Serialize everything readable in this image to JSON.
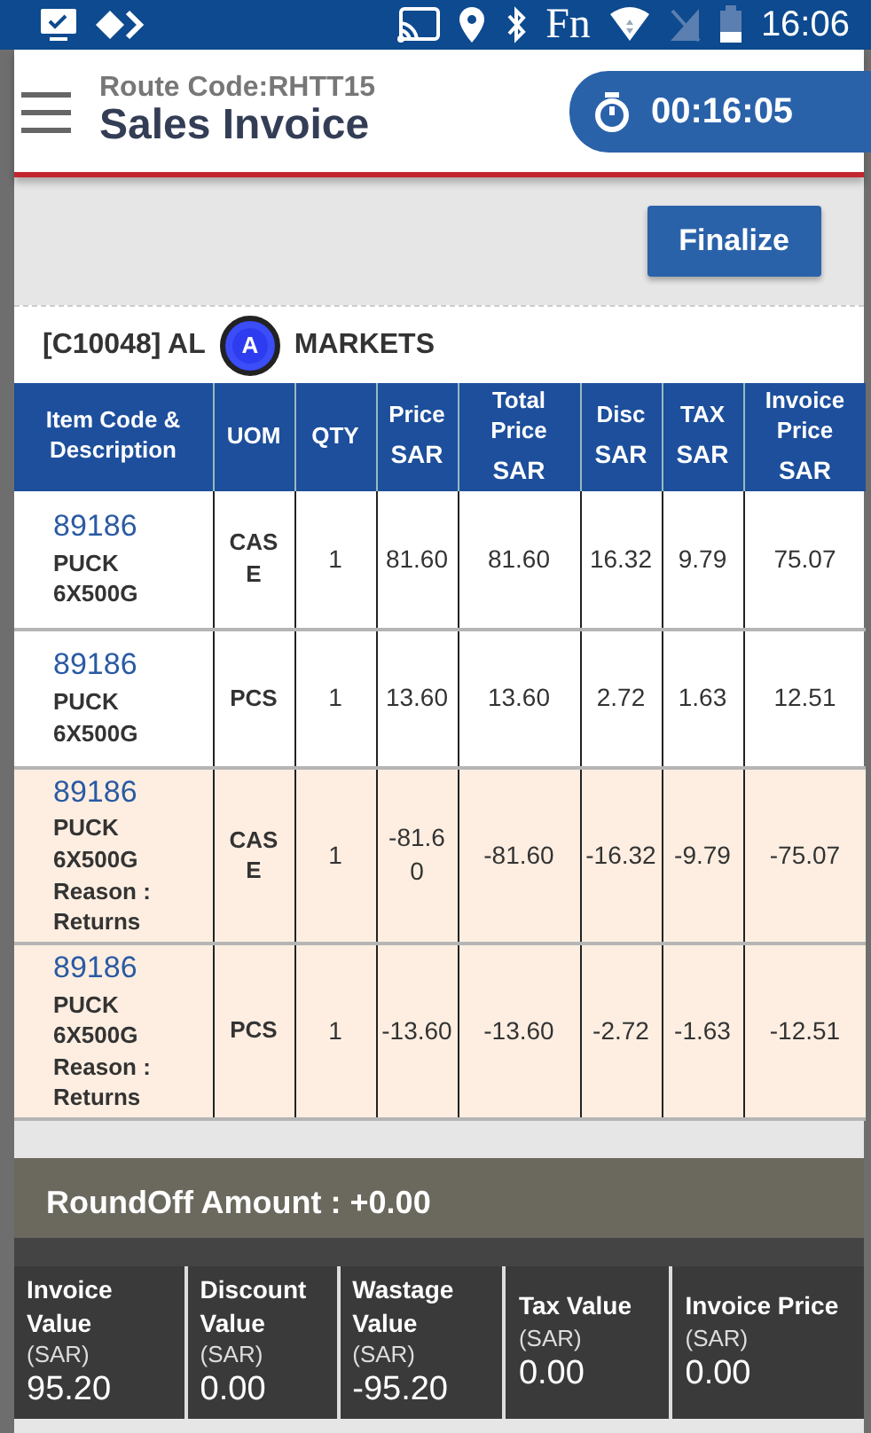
{
  "status_bar": {
    "fn": "Fn",
    "time": "16:06"
  },
  "header": {
    "route": "Route Code:RHTT15",
    "title": "Sales Invoice",
    "timer": "00:16:05"
  },
  "finalize_button": "Finalize",
  "customer": {
    "before": "[C10048] AL",
    "after": "MARKETS",
    "touch_mark": "A"
  },
  "table": {
    "columns": [
      {
        "label": "Item Code & Description"
      },
      {
        "label": "UOM"
      },
      {
        "label": "QTY"
      },
      {
        "label": "Price",
        "unit": "SAR"
      },
      {
        "label": "Total Price",
        "unit": "SAR"
      },
      {
        "label": "Disc",
        "unit": "SAR"
      },
      {
        "label": "TAX",
        "unit": "SAR"
      },
      {
        "label": "Invoice Price",
        "unit": "SAR"
      }
    ],
    "rows": [
      {
        "kind": "sale",
        "code": "89186",
        "description": "PUCK 6X500G",
        "uom": "CAS E",
        "qty": "1",
        "price": "81.60",
        "total": "81.60",
        "disc": "16.32",
        "tax": "9.79",
        "invoice": "75.07"
      },
      {
        "kind": "sale",
        "code": "89186",
        "description": "PUCK 6X500G",
        "uom": "PCS",
        "qty": "1",
        "price": "13.60",
        "total": "13.60",
        "disc": "2.72",
        "tax": "1.63",
        "invoice": "12.51"
      },
      {
        "kind": "return",
        "code": "89186",
        "description": "PUCK 6X500G",
        "reason": "Reason : Returns",
        "uom": "CAS E",
        "qty": "1",
        "price": "-81.6 0",
        "total": "-81.60",
        "disc": "-16.32",
        "tax": "-9.79",
        "invoice": "-75.07"
      },
      {
        "kind": "return",
        "code": "89186",
        "description": "PUCK 6X500G",
        "reason": "Reason : Returns",
        "uom": "PCS",
        "qty": "1",
        "price": "-13.60",
        "total": "-13.60",
        "disc": "-2.72",
        "tax": "-1.63",
        "invoice": "-12.51"
      }
    ]
  },
  "roundoff": "RoundOff Amount : +0.00",
  "summary": [
    {
      "label": "Invoice Value",
      "unit": "(SAR)",
      "value": "95.20"
    },
    {
      "label": "Discount Value",
      "unit": "(SAR)",
      "value": "0.00"
    },
    {
      "label": "Wastage Value",
      "unit": "(SAR)",
      "value": "-95.20"
    },
    {
      "label": "Tax Value",
      "unit": "(SAR)",
      "value": "0.00"
    },
    {
      "label": "Invoice Price",
      "unit": "(SAR)",
      "value": "0.00"
    }
  ]
}
